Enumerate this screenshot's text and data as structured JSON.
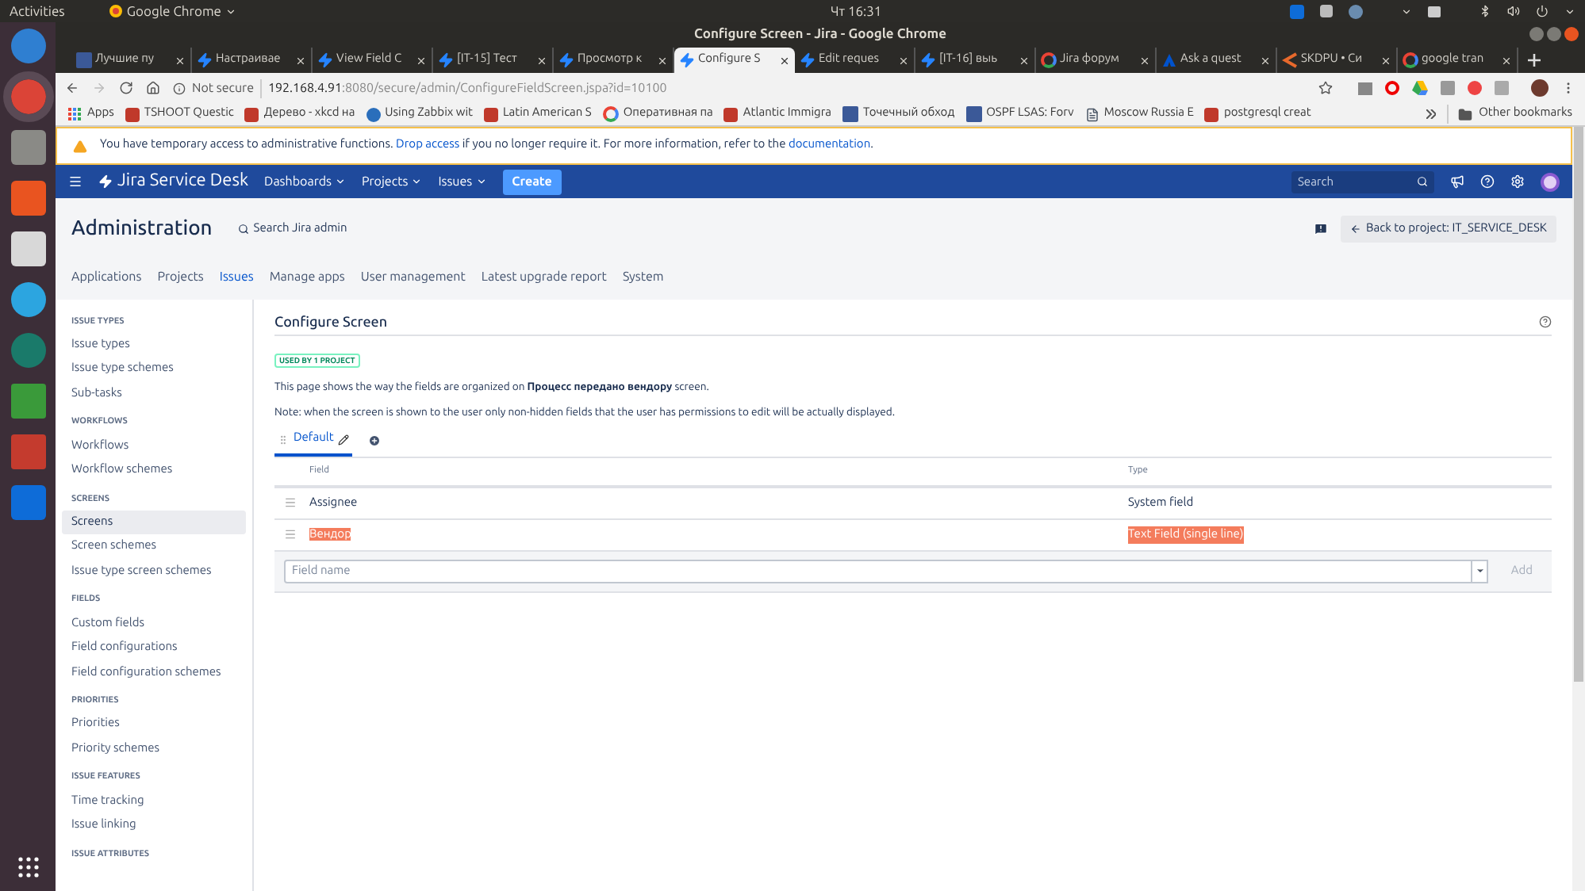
{
  "topbar": {
    "activities": "Activities",
    "app_menu": "Google Chrome",
    "clock": "Чт 16:31"
  },
  "window": {
    "title": "Configure Screen - Jira - Google Chrome"
  },
  "tabs": [
    {
      "label": "Лучшие пу",
      "kind": "h",
      "selected": false
    },
    {
      "label": "Настраивае",
      "kind": "jira",
      "selected": false
    },
    {
      "label": "View Field C",
      "kind": "jira",
      "selected": false
    },
    {
      "label": "[IT-15] Тест",
      "kind": "jira",
      "selected": false
    },
    {
      "label": "Просмотр к",
      "kind": "jira",
      "selected": false
    },
    {
      "label": "Configure S",
      "kind": "jira",
      "selected": true
    },
    {
      "label": "Edit reques",
      "kind": "jira",
      "selected": false
    },
    {
      "label": "[IT-16] выь",
      "kind": "jira",
      "selected": false
    },
    {
      "label": "Jira форум",
      "kind": "google",
      "selected": false
    },
    {
      "label": "Ask a quest",
      "kind": "atlassian",
      "selected": false
    },
    {
      "label": "SKDPU • Си",
      "kind": "skdpu",
      "selected": false
    },
    {
      "label": "google tran",
      "kind": "google",
      "selected": false
    }
  ],
  "address": {
    "security": "Not secure",
    "host": "192.168.4.91",
    "path": ":8080/secure/admin/ConfigureFieldScreen.jspa?id=10100"
  },
  "bookmarks": [
    {
      "label": "Apps",
      "kind": "apps"
    },
    {
      "label": "TSHOOT Questic",
      "kind": "generic"
    },
    {
      "label": "Дерево - xkcd на",
      "kind": "generic"
    },
    {
      "label": "Using Zabbix wit",
      "kind": "globe"
    },
    {
      "label": "Latin American S",
      "kind": "generic"
    },
    {
      "label": "Оперативная па",
      "kind": "google"
    },
    {
      "label": "Atlantic Immigra",
      "kind": "generic"
    },
    {
      "label": "Точечный обход",
      "kind": "h"
    },
    {
      "label": "OSPF LSAS: Forv",
      "kind": "h"
    },
    {
      "label": "Moscow Russia E",
      "kind": "page"
    },
    {
      "label": "postgresql creat",
      "kind": "generic"
    }
  ],
  "other_bookmarks": "Other bookmarks",
  "banner": {
    "before": "You have temporary access to administrative functions.",
    "link1": "Drop access",
    "middle": "if you no longer require it. For more information, refer to the",
    "link2": "documentation",
    "after": "."
  },
  "jira": {
    "logo": "Jira Service Desk",
    "menus": [
      "Dashboards",
      "Projects",
      "Issues"
    ],
    "create": "Create",
    "search_placeholder": "Search"
  },
  "admin": {
    "title": "Administration",
    "search": "Search Jira admin",
    "back": "Back to project: IT_SERVICE_DESK",
    "tabs": [
      {
        "label": "Applications",
        "selected": false
      },
      {
        "label": "Projects",
        "selected": false
      },
      {
        "label": "Issues",
        "selected": true
      },
      {
        "label": "Manage apps",
        "selected": false
      },
      {
        "label": "User management",
        "selected": false
      },
      {
        "label": "Latest upgrade report",
        "selected": false
      },
      {
        "label": "System",
        "selected": false
      }
    ]
  },
  "sidebar": [
    {
      "heading": "ISSUE TYPES",
      "items": [
        {
          "label": "Issue types",
          "selected": false
        },
        {
          "label": "Issue type schemes",
          "selected": false
        },
        {
          "label": "Sub-tasks",
          "selected": false
        }
      ]
    },
    {
      "heading": "WORKFLOWS",
      "items": [
        {
          "label": "Workflows",
          "selected": false
        },
        {
          "label": "Workflow schemes",
          "selected": false
        }
      ]
    },
    {
      "heading": "SCREENS",
      "items": [
        {
          "label": "Screens",
          "selected": true
        },
        {
          "label": "Screen schemes",
          "selected": false
        },
        {
          "label": "Issue type screen schemes",
          "selected": false
        }
      ]
    },
    {
      "heading": "FIELDS",
      "items": [
        {
          "label": "Custom fields",
          "selected": false
        },
        {
          "label": "Field configurations",
          "selected": false
        },
        {
          "label": "Field configuration schemes",
          "selected": false
        }
      ]
    },
    {
      "heading": "PRIORITIES",
      "items": [
        {
          "label": "Priorities",
          "selected": false
        },
        {
          "label": "Priority schemes",
          "selected": false
        }
      ]
    },
    {
      "heading": "ISSUE FEATURES",
      "items": [
        {
          "label": "Time tracking",
          "selected": false
        },
        {
          "label": "Issue linking",
          "selected": false
        }
      ]
    },
    {
      "heading": "ISSUE ATTRIBUTES"
    }
  ],
  "content": {
    "title": "Configure Screen",
    "badge": "USED BY 1 PROJECT",
    "description": "This page shows the way the fields are organized on **Процесс передано вендору** screen.",
    "note": "Note: when the screen is shown to the user only non-hidden fields that the user has permissions to edit will be actually displayed.",
    "screen_tabs": [
      {
        "label": "Default",
        "selected": true
      }
    ],
    "columns": [
      "Field",
      "Type"
    ],
    "rows": [
      {
        "field": "Assignee",
        "type": "System field",
        "highlighted": false
      },
      {
        "field": "Вендор",
        "type": "Text Field (single line)",
        "highlighted": true
      }
    ],
    "field_placeholder": "Field name",
    "add": "Add"
  }
}
